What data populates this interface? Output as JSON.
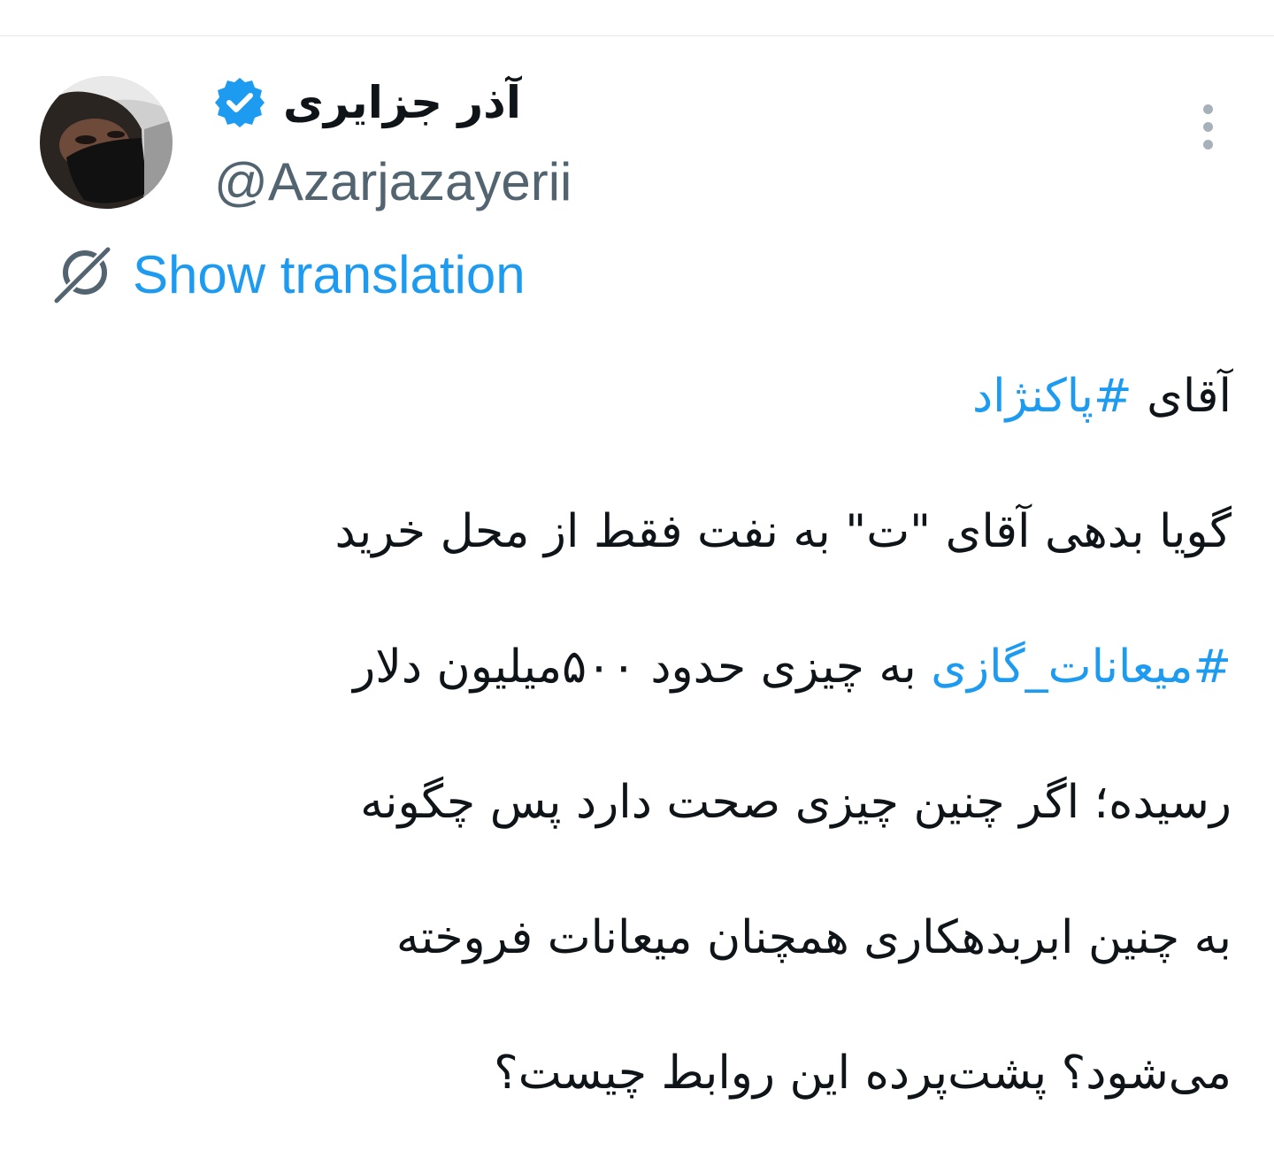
{
  "tweet": {
    "author": {
      "display_name": "آذر جزایری",
      "handle": "@Azarjazayerii",
      "verified": true
    },
    "show_translation_label": "Show translation",
    "lines": [
      {
        "parts": [
          {
            "text": "آقای ",
            "type": "text"
          },
          {
            "text": "#پاکنژاد",
            "type": "hashtag"
          }
        ]
      },
      {
        "parts": [
          {
            "text": "گویا بدهی آقای \"ت\" به نفت فقط از محل خرید",
            "type": "text"
          }
        ]
      },
      {
        "parts": [
          {
            "text": "#میعانات_گازی",
            "type": "hashtag"
          },
          {
            "text": " به چیزی حدود ۵۰۰میلیون دلار",
            "type": "text"
          }
        ]
      },
      {
        "parts": [
          {
            "text": "رسیده؛ اگر چنین چیزی صحت دارد پس چگونه",
            "type": "text"
          }
        ]
      },
      {
        "parts": [
          {
            "text": "به چنین ابربدهکاری همچنان میعانات فروخته",
            "type": "text"
          }
        ]
      },
      {
        "parts": [
          {
            "text": "می‌شود؟ پشت‌پرده این روابط چیست؟",
            "type": "text"
          }
        ]
      }
    ]
  },
  "icons": {
    "avatar": "profile-photo",
    "verified": "verified-badge-icon",
    "more": "more-vertical-icon",
    "translate": "globe-translate-icon"
  },
  "colors": {
    "accent": "#1d9bf0",
    "text_primary": "#0f1419",
    "text_secondary": "#536471",
    "icon_muted": "#a7b1b9"
  }
}
